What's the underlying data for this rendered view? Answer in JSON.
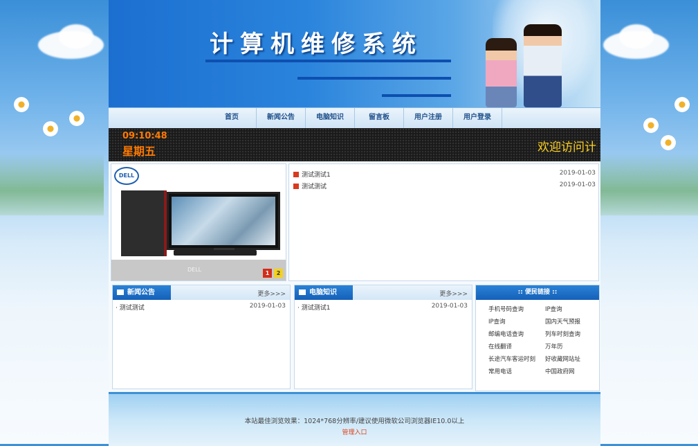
{
  "banner": {
    "title": "计算机维修系统"
  },
  "nav": {
    "items": [
      "首页",
      "新闻公告",
      "电脑知识",
      "留言板",
      "用户注册",
      "用户登录"
    ]
  },
  "led": {
    "time": "09:10:48",
    "day": "星期五",
    "welcome": "欢迎访问计"
  },
  "slider": {
    "logo": "DELL",
    "caption": "DELL",
    "pages": [
      "1",
      "2"
    ]
  },
  "top_news": [
    {
      "title": "测试测试1",
      "date": "2019-01-03"
    },
    {
      "title": "测试测试",
      "date": "2019-01-03"
    }
  ],
  "news_box": {
    "title": "新闻公告",
    "more": "更多>>>",
    "items": [
      {
        "title": "测试测试",
        "date": "2019-01-03"
      }
    ]
  },
  "knowledge_box": {
    "title": "电脑知识",
    "more": "更多>>>",
    "items": [
      {
        "title": "测试测试1",
        "date": "2019-01-03"
      }
    ]
  },
  "links_box": {
    "title": ":: 便民链接 ::",
    "left": [
      "手机号码查询",
      "IP查询",
      "邮编电话查询",
      "在线翻译",
      "长途汽车客运时刻",
      "常用电话"
    ],
    "right": [
      "IP查询",
      "国内天气预报",
      "列车时刻查询",
      "万年历",
      "好收藏网站址",
      "中国政府网"
    ]
  },
  "footer": {
    "notice": "本站最佳浏览效果：1024*768分辨率/建议使用微软公司浏览器IE10.0以上",
    "admin_link": "管理入口"
  },
  "colors": {
    "accent": "#1560b8",
    "led_time": "#ff7a00",
    "led_welcome": "#ffd21e",
    "admin_link": "#e0461f"
  }
}
